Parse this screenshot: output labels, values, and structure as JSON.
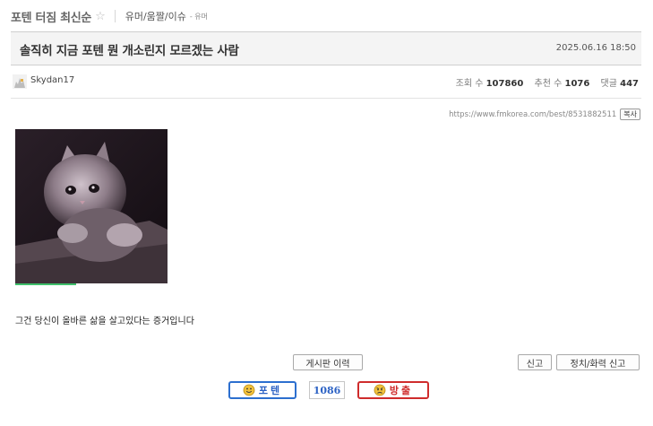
{
  "header": {
    "board_title": "포텐 터짐 최신순",
    "category": "유머/움짤/이슈",
    "subcategory": "- 유머"
  },
  "post": {
    "title": "솔직히 지금 포텐 뭔 개소린지 모르겠는 사람",
    "date": "2025.06.16 18:50",
    "author": "Skydan17",
    "url": "https://www.fmkorea.com/best/8531882511",
    "copy_label": "복사",
    "body": "그건 당신이 올바른 삶을 살고있다는 증거입니다",
    "gif_progress": 0.4
  },
  "stats": {
    "views_label": "조회 수",
    "views": "107860",
    "recommend_label": "추천 수",
    "recommend": "1076",
    "comments_label": "댓글",
    "comments": "447"
  },
  "actions": {
    "board_history": "게시판 이력",
    "report": "신고",
    "political_report": "정치/화력 신고"
  },
  "votes": {
    "up_label": "포텐",
    "count": "1086",
    "down_label": "방출"
  },
  "colors": {
    "vote_up": "#2c6fcf",
    "vote_down": "#cf2c2c",
    "progress": "#3fc06b"
  }
}
